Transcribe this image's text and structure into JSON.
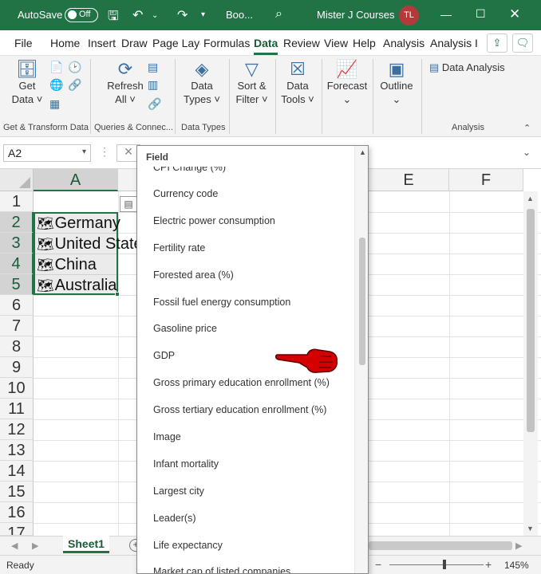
{
  "titlebar": {
    "autosave_label": "AutoSave",
    "autosave_state": "Off",
    "filename": "Boo...",
    "account": "Mister J Courses",
    "avatar_initials": "TL"
  },
  "tabs": [
    "File",
    "Home",
    "Insert",
    "Draw",
    "Page Layout",
    "Formulas",
    "Data",
    "Review",
    "View",
    "Help",
    "Analysis",
    "Analysis I"
  ],
  "ribbon": {
    "get_data": [
      "Get",
      "Data ˅"
    ],
    "refresh": [
      "Refresh",
      "All ˅"
    ],
    "data_types": [
      "Data",
      "Types ˅"
    ],
    "sort_filter": [
      "Sort &",
      "Filter ˅"
    ],
    "data_tools": [
      "Data",
      "Tools ˅"
    ],
    "forecast": "Forecast",
    "outline": "Outline",
    "data_analysis": "Data Analysis",
    "groups": [
      "Get & Transform Data",
      "Queries & Connec...",
      "Data Types",
      "Analysis"
    ]
  },
  "formulabar": {
    "namebox": "A2"
  },
  "grid": {
    "columns": [
      "A",
      "E",
      "F"
    ],
    "rows": [
      "1",
      "2",
      "3",
      "4",
      "5",
      "6",
      "7",
      "8",
      "9",
      "10",
      "11",
      "12",
      "13",
      "14",
      "15",
      "16",
      "17"
    ],
    "cells": [
      "Germany",
      "United States",
      "China",
      "Australia"
    ]
  },
  "sheet": {
    "tab": "Sheet1"
  },
  "status": {
    "ready": "Ready",
    "zoom": "145%"
  },
  "field_list": {
    "header": "Field",
    "items": [
      "CPI Change (%)",
      "Currency code",
      "Electric power consumption",
      "Fertility rate",
      "Forested area (%)",
      "Fossil fuel energy consumption",
      "Gasoline price",
      "GDP",
      "Gross primary education enrollment (%)",
      "Gross tertiary education enrollment (%)",
      "Image",
      "Infant mortality",
      "Largest city",
      "Leader(s)",
      "Life expectancy",
      "Market cap of listed companies"
    ]
  },
  "colors": {
    "excel_green": "#217346",
    "pointer_red": "#d40000"
  }
}
